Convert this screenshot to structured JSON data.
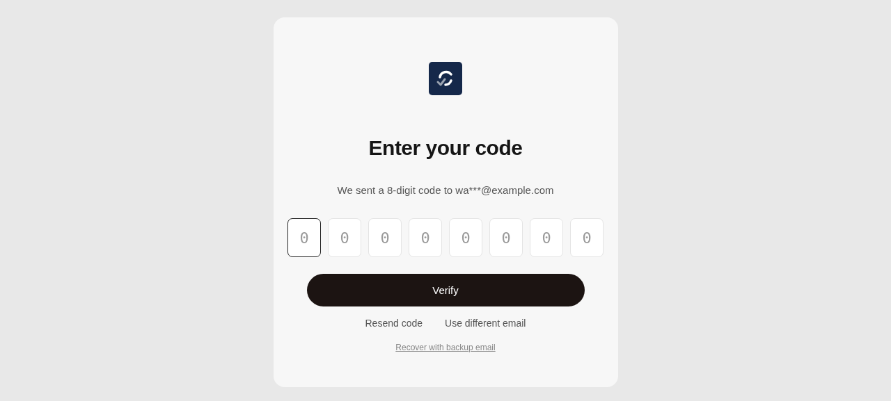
{
  "title": "Enter your code",
  "subtitle": "We sent a 8-digit code to wa***@example.com",
  "code_inputs": [
    {
      "placeholder": "0",
      "focused": true
    },
    {
      "placeholder": "0",
      "focused": false
    },
    {
      "placeholder": "0",
      "focused": false
    },
    {
      "placeholder": "0",
      "focused": false
    },
    {
      "placeholder": "0",
      "focused": false
    },
    {
      "placeholder": "0",
      "focused": false
    },
    {
      "placeholder": "0",
      "focused": false
    },
    {
      "placeholder": "0",
      "focused": false
    }
  ],
  "verify_button": "Verify",
  "links": [
    "Resend code",
    "Use different email"
  ],
  "recover_link": "Recover with backup email"
}
